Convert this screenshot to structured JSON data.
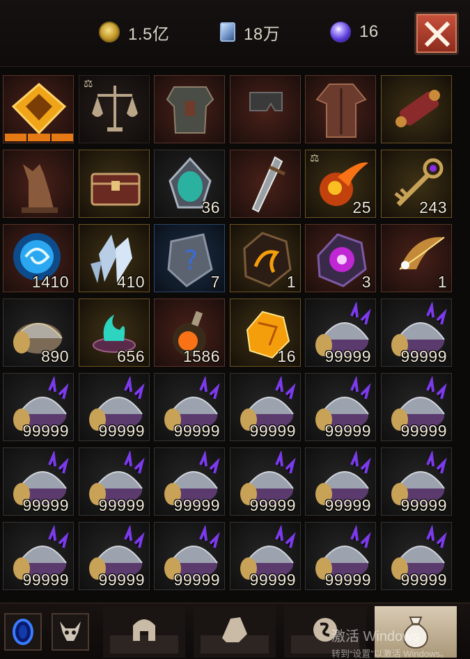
{
  "currencies": {
    "gold": {
      "icon": "gold-coin-icon",
      "value": "1.5亿"
    },
    "card": {
      "icon": "blue-card-icon",
      "value": "18万"
    },
    "orb": {
      "icon": "purple-orb-icon",
      "value": "16"
    }
  },
  "close_icon": "close-x-icon",
  "inventory": {
    "rows": [
      [
        {
          "icon": "golden-prism-icon",
          "quality": "q-red",
          "count": ""
        },
        {
          "icon": "scales-icon",
          "quality": "q-dark",
          "count": ""
        },
        {
          "icon": "chest-armor-icon",
          "quality": "q-red",
          "count": ""
        },
        {
          "icon": "pants-icon",
          "quality": "q-red",
          "count": ""
        },
        {
          "icon": "robe-armor-icon",
          "quality": "q-red",
          "count": ""
        },
        {
          "icon": "scroll-icon",
          "quality": "q-gold",
          "count": ""
        }
      ],
      [
        {
          "icon": "wolf-statue-icon",
          "quality": "q-red",
          "count": ""
        },
        {
          "icon": "treasure-chest-icon",
          "quality": "q-gold",
          "count": ""
        },
        {
          "icon": "mask-head-icon",
          "quality": "q-gray",
          "count": "36"
        },
        {
          "icon": "greatsword-icon",
          "quality": "q-red",
          "count": ""
        },
        {
          "icon": "fire-orb-icon",
          "quality": "q-gold",
          "count": "25"
        },
        {
          "icon": "ornate-key-icon",
          "quality": "q-gold",
          "count": "243"
        }
      ],
      [
        {
          "icon": "blue-swirl-icon",
          "quality": "q-red",
          "count": "1410"
        },
        {
          "icon": "crystal-shard-icon",
          "quality": "q-gold",
          "count": "410"
        },
        {
          "icon": "mystery-rune-icon",
          "quality": "q-blue",
          "count": "7"
        },
        {
          "icon": "dragon-stone-icon",
          "quality": "q-gold",
          "count": "1"
        },
        {
          "icon": "purple-void-icon",
          "quality": "q-red",
          "count": "3"
        },
        {
          "icon": "feather-icon",
          "quality": "q-red",
          "count": "1"
        }
      ],
      [
        {
          "icon": "gold-helmet-icon",
          "quality": "q-gray",
          "count": "890"
        },
        {
          "icon": "teal-brazier-icon",
          "quality": "q-gold",
          "count": "656"
        },
        {
          "icon": "fire-potion-icon",
          "quality": "q-red",
          "count": "1586"
        },
        {
          "icon": "amber-gem-icon",
          "quality": "q-gold",
          "count": "16"
        },
        {
          "icon": "purple-helmet-icon",
          "quality": "q-gray",
          "count": "99999"
        },
        {
          "icon": "purple-helmet-icon",
          "quality": "q-gray",
          "count": "99999"
        }
      ],
      [
        {
          "icon": "purple-helmet-icon",
          "quality": "q-gray",
          "count": "99999"
        },
        {
          "icon": "purple-helmet-icon",
          "quality": "q-gray",
          "count": "99999"
        },
        {
          "icon": "purple-helmet-icon",
          "quality": "q-gray",
          "count": "99999"
        },
        {
          "icon": "purple-helmet-icon",
          "quality": "q-gray",
          "count": "99999"
        },
        {
          "icon": "purple-helmet-icon",
          "quality": "q-gray",
          "count": "99999"
        },
        {
          "icon": "purple-helmet-icon",
          "quality": "q-gray",
          "count": "99999"
        }
      ],
      [
        {
          "icon": "purple-helmet-icon",
          "quality": "q-gray",
          "count": "99999"
        },
        {
          "icon": "purple-helmet-icon",
          "quality": "q-gray",
          "count": "99999"
        },
        {
          "icon": "purple-helmet-icon",
          "quality": "q-gray",
          "count": "99999"
        },
        {
          "icon": "purple-helmet-icon",
          "quality": "q-gray",
          "count": "99999"
        },
        {
          "icon": "purple-helmet-icon",
          "quality": "q-gray",
          "count": "99999"
        },
        {
          "icon": "purple-helmet-icon",
          "quality": "q-gray",
          "count": "99999"
        }
      ],
      [
        {
          "icon": "purple-helmet-icon",
          "quality": "q-gray",
          "count": "99999"
        },
        {
          "icon": "purple-helmet-icon",
          "quality": "q-gray",
          "count": "99999"
        },
        {
          "icon": "purple-helmet-icon",
          "quality": "q-gray",
          "count": "99999"
        },
        {
          "icon": "purple-helmet-icon",
          "quality": "q-gray",
          "count": "99999"
        },
        {
          "icon": "purple-helmet-icon",
          "quality": "q-gray",
          "count": "99999"
        },
        {
          "icon": "purple-helmet-icon",
          "quality": "q-gray",
          "count": "99999"
        }
      ]
    ]
  },
  "bottom": {
    "buttons": [
      {
        "icon": "blue-portal-icon"
      },
      {
        "icon": "demon-skull-icon"
      }
    ],
    "tabs": [
      {
        "icon": "helmet-tab-icon",
        "active": false
      },
      {
        "icon": "gem-tab-icon",
        "active": false
      },
      {
        "icon": "rune-tab-icon",
        "active": false
      },
      {
        "icon": "pouch-tab-icon",
        "active": true
      }
    ]
  },
  "watermark": {
    "line1": "激活 Windows",
    "line2": "转到“设置”以激活 Windows。"
  },
  "colors": {
    "accent_orange": "#e57a14",
    "close_red": "#b5412e",
    "count_text": "#f2ead8"
  }
}
